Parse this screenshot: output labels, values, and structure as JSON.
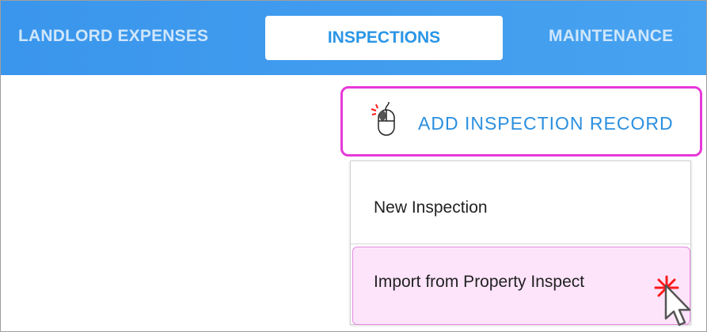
{
  "tabs": {
    "left": "LANDLORD EXPENSES",
    "active": "INSPECTIONS",
    "right": "MAINTENANCE"
  },
  "add_button": {
    "label": "ADD INSPECTION RECORD",
    "icon": "mouse-click-icon"
  },
  "menu": {
    "items": [
      {
        "label": "New Inspection"
      },
      {
        "label": "Import from Property Inspect"
      }
    ]
  },
  "colors": {
    "tabbar_blue": "#3a96ec",
    "accent_blue": "#2a8fe0",
    "highlight_magenta": "#e63ad8",
    "hover_pink": "#fde4fb",
    "click_red": "#ff1a1a"
  }
}
